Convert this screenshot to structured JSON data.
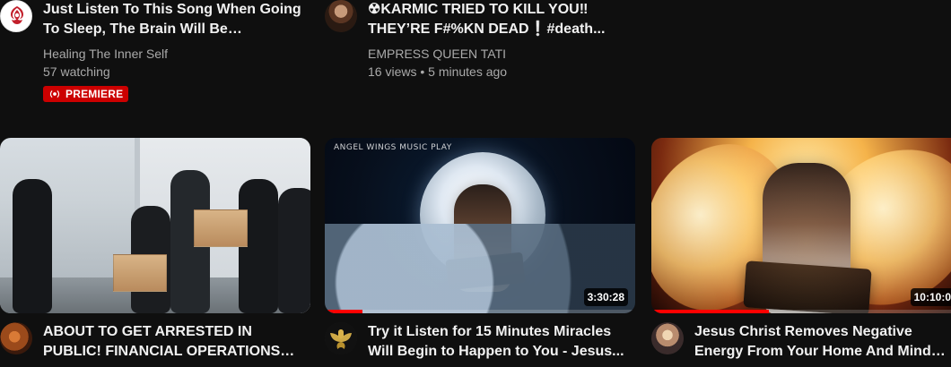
{
  "top_row": [
    {
      "title": "Just Listen To This Song When Going To Sleep, The Brain Will Be Massaged...",
      "channel": "Healing The Inner Self",
      "stats": "57 watching",
      "badge": "PREMIERE",
      "avatar_icon": "healing-logo-icon"
    },
    {
      "title": "☢KARMIC TRIED TO KILL YOU‼ THEY’RE F#%KN DEAD❕#death...",
      "channel": "EMPRESS QUEEN TATI",
      "stats": "16 views • 5 minutes ago",
      "avatar_icon": "channel-avatar-icon"
    }
  ],
  "thumb_row": [
    {
      "title": "ABOUT TO GET ARRESTED IN PUBLIC! FINANCIAL OPERATIONS GROUP! LL...",
      "avatar_icon": "channel-avatar-icon"
    },
    {
      "title": "Try it Listen for 15 Minutes Miracles Will Begin to Happen to You - Jesus...",
      "duration": "3:30:28",
      "overlay_text": "ANGEL WINGS MUSIC PLAY",
      "progress": 0.12,
      "avatar_icon": "moth-icon"
    },
    {
      "title": "Jesus Christ Removes Negative Energy From Your Home And Mind Music...",
      "duration": "10:10:0",
      "progress": 0.38,
      "avatar_icon": "channel-avatar-icon"
    }
  ],
  "colors": {
    "background": "#0f0f0f",
    "primary_text": "#f1f1f1",
    "secondary_text": "#aaaaaa",
    "premiere_red": "#cc0000",
    "progress_red": "#ff0000"
  }
}
